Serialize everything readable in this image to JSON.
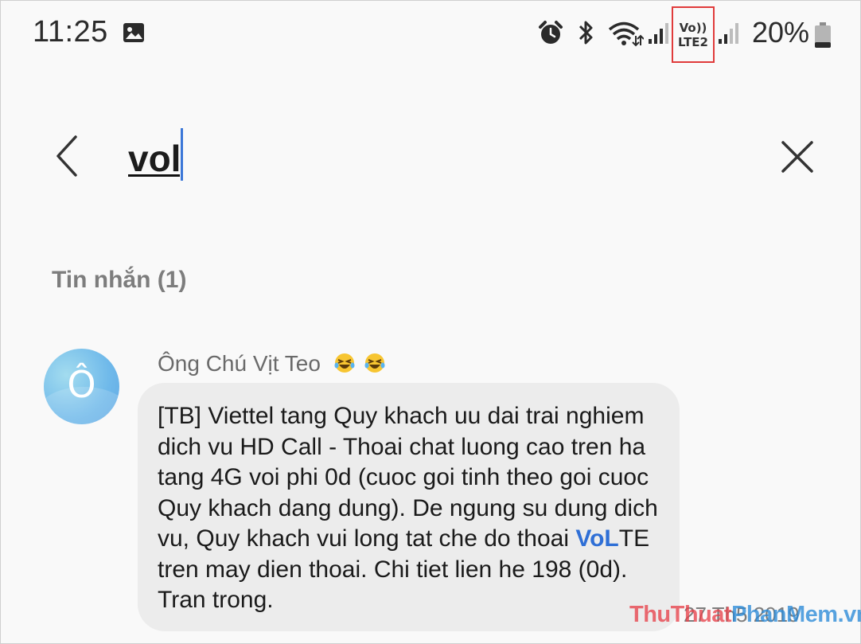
{
  "status_bar": {
    "time": "11:25",
    "network_badge_top": "Vo))",
    "network_badge_bottom": "LTE2",
    "battery_percent": "20%",
    "highlight_color": "#e03b3b",
    "icons": [
      "gallery-icon",
      "alarm-icon",
      "bluetooth-icon",
      "wifi-icon",
      "signal-icon",
      "signal-icon",
      "battery-icon"
    ]
  },
  "search": {
    "query": "vol",
    "cursor_color": "#3b77d8",
    "back_icon": "chevron-left-icon",
    "clear_icon": "close-icon"
  },
  "results": {
    "section_label": "Tin nhắn (1)",
    "messages": [
      {
        "avatar_letter": "Ô",
        "sender": "Ông Chú Vịt Teo",
        "sender_emojis": [
          "rolling-laughing-emoji",
          "rolling-laughing-emoji"
        ],
        "text_before": "[TB] Viettel tang Quy khach uu dai trai nghiem dich vu HD Call - Thoai chat luong cao tren ha tang 4G voi phi 0d (cuoc goi tinh theo goi cuoc Quy khach dang dung). De ngung su dung dich vu, Quy khach vui long tat che do thoai ",
        "text_match": "VoL",
        "text_after": "TE tren may dien thoai. Chi tiet lien he 198 (0d). Tran trong.",
        "match_color": "#2f6fd6",
        "date": "27 Th5 2019"
      }
    ]
  },
  "watermark": {
    "part1": "Thu",
    "part2": "Thuat",
    "part3": "Phan",
    "part4": "Mem",
    "part5": ".vn",
    "color1": "#e8424b",
    "color2": "#2a8ad8"
  }
}
